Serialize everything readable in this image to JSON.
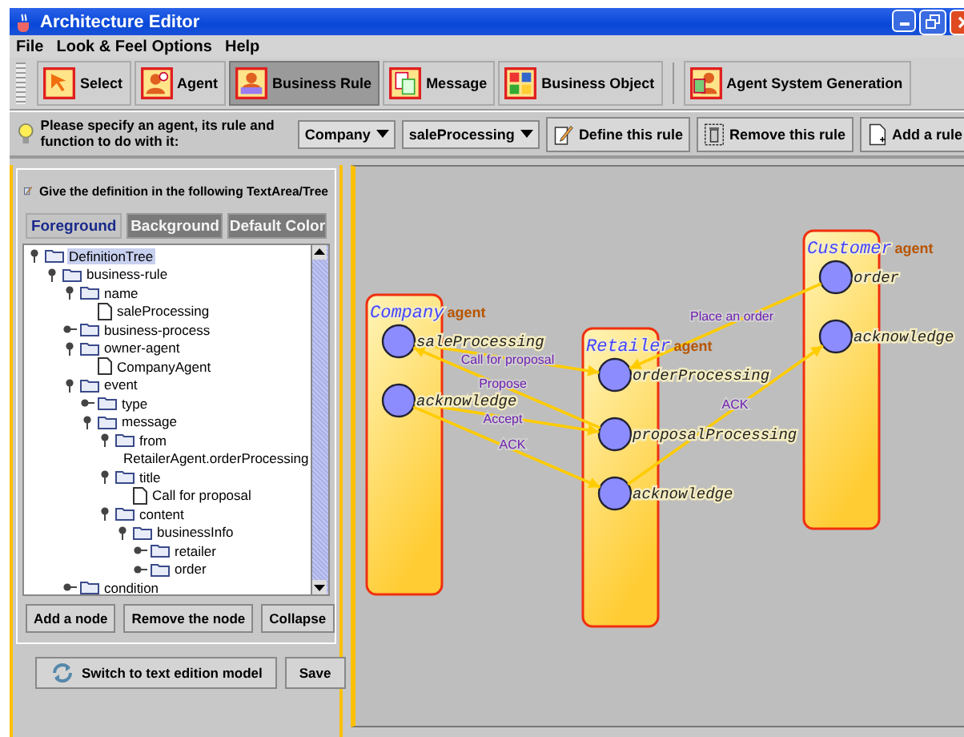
{
  "window": {
    "title": "Architecture Editor"
  },
  "menu": [
    "File",
    "Look & Feel Options",
    "Help"
  ],
  "toolbar": [
    {
      "label": "Select",
      "kind": "cursor",
      "selected": false
    },
    {
      "label": "Agent",
      "kind": "agent",
      "selected": false
    },
    {
      "label": "Business Rule",
      "kind": "rule",
      "selected": true
    },
    {
      "label": "Message",
      "kind": "message",
      "selected": false
    },
    {
      "label": "Business Object",
      "kind": "object",
      "selected": false
    },
    {
      "label": "Agent System Generation",
      "kind": "generation",
      "selected": false
    }
  ],
  "rule_bar": {
    "prompt": "Please specify an agent, its rule and function to do with it:",
    "agent": "Company",
    "function": "saleProcessing",
    "buttons": [
      {
        "label": "Define this rule",
        "kind": "pencil"
      },
      {
        "label": "Remove this rule",
        "kind": "trash"
      },
      {
        "label": "Add a rule",
        "kind": "page"
      }
    ]
  },
  "definition_panel": {
    "heading": "Give the definition in the following TextArea/Tree",
    "color_buttons": [
      {
        "label": "Foreground",
        "disabled": false
      },
      {
        "label": "Background",
        "disabled": true
      },
      {
        "label": "Default Color",
        "disabled": true
      }
    ],
    "tree": {
      "label": "DefinitionTree",
      "kind": "folder",
      "expanded": true,
      "selected": true,
      "children": [
        {
          "label": "business-rule",
          "kind": "folder",
          "expanded": true,
          "selected": false,
          "children": [
            {
              "label": "name",
              "kind": "folder",
              "expanded": true,
              "selected": false,
              "children": [
                {
                  "label": "saleProcessing",
                  "kind": "leaf",
                  "selected": false
                }
              ]
            },
            {
              "label": "business-process",
              "kind": "folder",
              "expanded": false,
              "selected": false
            },
            {
              "label": "owner-agent",
              "kind": "folder",
              "expanded": true,
              "selected": false,
              "children": [
                {
                  "label": "CompanyAgent",
                  "kind": "leaf",
                  "selected": false
                }
              ]
            },
            {
              "label": "event",
              "kind": "folder",
              "expanded": true,
              "selected": false,
              "children": [
                {
                  "label": "type",
                  "kind": "folder",
                  "expanded": false,
                  "selected": false
                },
                {
                  "label": "message",
                  "kind": "folder",
                  "expanded": true,
                  "selected": false,
                  "children": [
                    {
                      "label": "from",
                      "kind": "folder",
                      "expanded": true,
                      "selected": false,
                      "children": [
                        {
                          "label": "RetailerAgent.orderProcessing",
                          "kind": "leaf",
                          "selected": false
                        }
                      ]
                    },
                    {
                      "label": "title",
                      "kind": "folder",
                      "expanded": true,
                      "selected": false,
                      "children": [
                        {
                          "label": "Call for proposal",
                          "kind": "leaf",
                          "selected": false
                        }
                      ]
                    },
                    {
                      "label": "content",
                      "kind": "folder",
                      "expanded": true,
                      "selected": false,
                      "children": [
                        {
                          "label": "businessInfo",
                          "kind": "folder",
                          "expanded": true,
                          "selected": false,
                          "children": [
                            {
                              "label": "retailer",
                              "kind": "folder",
                              "expanded": false,
                              "selected": false
                            },
                            {
                              "label": "order",
                              "kind": "folder",
                              "expanded": false,
                              "selected": false
                            }
                          ]
                        }
                      ]
                    }
                  ]
                }
              ]
            },
            {
              "label": "condition",
              "kind": "folder",
              "expanded": false,
              "selected": false
            }
          ]
        }
      ]
    },
    "tree_buttons": [
      "Add a node",
      "Remove the node",
      "Collapse"
    ],
    "switch_button": "Switch to text edition model",
    "save_button": "Save"
  },
  "diagram": {
    "agents": [
      {
        "name": "Company",
        "role": "agent",
        "functions": [
          "saleProcessing",
          "acknowledge"
        ]
      },
      {
        "name": "Retailer",
        "role": "agent",
        "functions": [
          "orderProcessing",
          "proposalProcessing",
          "acknowledge"
        ]
      },
      {
        "name": "Customer",
        "role": "agent",
        "functions": [
          "order",
          "acknowledge"
        ]
      }
    ],
    "messages": [
      "Call for proposal",
      "Propose",
      "Accept",
      "ACK",
      "Place an order",
      "ACK"
    ]
  }
}
